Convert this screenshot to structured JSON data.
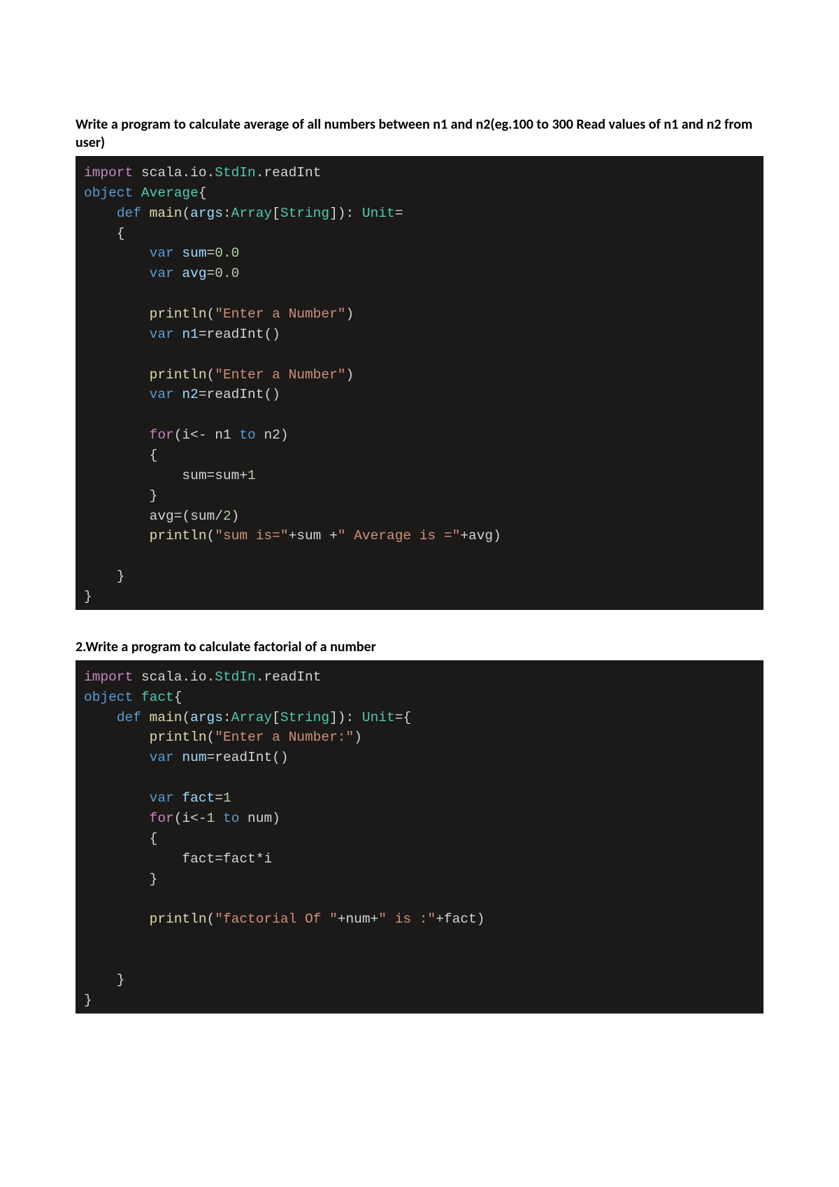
{
  "heading1": "Write a program to calculate average of all numbers between n1 and n2(eg.100 to 300 Read values of n1 and n2 from user)",
  "heading2": "2.Write a program to calculate factorial of a number",
  "code1": {
    "l1_import": "import",
    "l1_pkg": " scala.io.",
    "l1_cls": "StdIn",
    "l1_rest": ".readInt",
    "l2_object": "object",
    "l2_name": " Average",
    "l2_brace": "{",
    "l3_def": "def",
    "l3_main": " main",
    "l3_open": "(",
    "l3_args": "args",
    "l3_colon": ":",
    "l3_arr": "Array",
    "l3_lb": "[",
    "l3_str": "String",
    "l3_rb": "]",
    "l3_close": "): ",
    "l3_unit": "Unit",
    "l3_eq": "=",
    "l4_brace": "    {",
    "l5_var": "var",
    "l5_sum": " sum",
    "l5_eq": "=",
    "l5_val": "0.0",
    "l6_var": "var",
    "l6_avg": " avg",
    "l6_eq": "=",
    "l6_val": "0.0",
    "l7_fn": "println",
    "l7_open": "(",
    "l7_str": "\"Enter a Number\"",
    "l7_close": ")",
    "l8_var": "var",
    "l8_n1": " n1",
    "l8_eq": "=readInt()",
    "l9_fn": "println",
    "l9_open": "(",
    "l9_str": "\"Enter a Number\"",
    "l9_close": ")",
    "l10_var": "var",
    "l10_n2": " n2",
    "l10_eq": "=readInt()",
    "l11_for": "for",
    "l11_open": "(i<- n1 ",
    "l11_to": "to",
    "l11_rest": " n2)",
    "l12_brace": "        {",
    "l13_body": "            sum=sum+",
    "l13_one": "1",
    "l14_brace": "        }",
    "l15_avg": "        avg=(sum/",
    "l15_two": "2",
    "l15_close": ")",
    "l16_fn": "println",
    "l16_open": "(",
    "l16_str1": "\"sum is=\"",
    "l16_plus1": "+sum +",
    "l16_str2": "\" Average is =\"",
    "l16_plus2": "+avg)",
    "l17_brace": "    }",
    "l18_brace": "}"
  },
  "code2": {
    "l1_import": "import",
    "l1_pkg": " scala.io.",
    "l1_cls": "StdIn",
    "l1_rest": ".readInt",
    "l2_object": "object",
    "l2_name": " fact",
    "l2_brace": "{",
    "l3_def": "def",
    "l3_main": " main",
    "l3_open": "(",
    "l3_args": "args",
    "l3_colon": ":",
    "l3_arr": "Array",
    "l3_lb": "[",
    "l3_str": "String",
    "l3_rb": "]",
    "l3_close": "): ",
    "l3_unit": "Unit",
    "l3_eq": "={",
    "l4_fn": "println",
    "l4_open": "(",
    "l4_str": "\"Enter a Number:\"",
    "l4_close": ")",
    "l5_var": "var",
    "l5_num": " num",
    "l5_eq": "=readInt()",
    "l6_var": "var",
    "l6_fact": " fact",
    "l6_eq": "=",
    "l6_one": "1",
    "l7_for": "for",
    "l7_open": "(i<-",
    "l7_one": "1",
    "l7_to": " to",
    "l7_rest": " num)",
    "l8_brace": "        {",
    "l9_body": "            fact=fact*i",
    "l10_brace": "        }",
    "l11_fn": "println",
    "l11_open": "(",
    "l11_str1": "\"factorial Of \"",
    "l11_plus1": "+num+",
    "l11_str2": "\" is :\"",
    "l11_plus2": "+fact)",
    "l12_brace": "    }",
    "l13_brace": "}"
  }
}
